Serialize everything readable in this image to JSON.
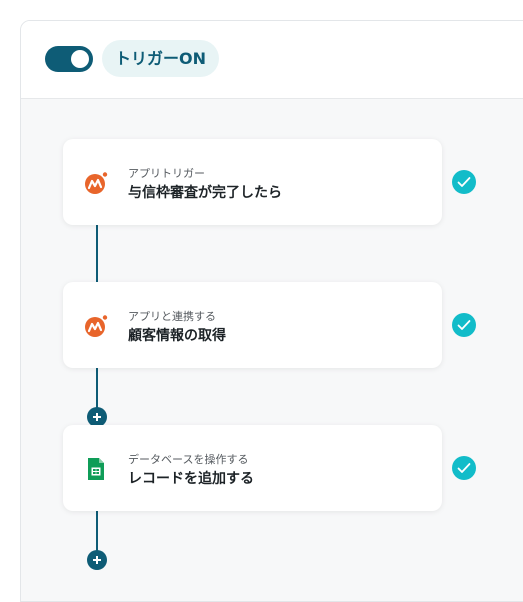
{
  "colors": {
    "accent": "#0e5c76",
    "check": "#12bcc9",
    "money_forward_orange": "#e8652b",
    "sheets_green": "#0f9d58"
  },
  "header": {
    "toggle_state": "on",
    "trigger_label": "トリガーON"
  },
  "steps": [
    {
      "icon": "money-forward-icon",
      "caption": "アプリトリガー",
      "title": "与信枠審査が完了したら",
      "status": "complete"
    },
    {
      "icon": "money-forward-icon",
      "caption": "アプリと連携する",
      "title": "顧客情報の取得",
      "status": "complete"
    },
    {
      "icon": "google-sheets-icon",
      "caption": "データベースを操作する",
      "title": "レコードを追加する",
      "status": "complete"
    }
  ]
}
